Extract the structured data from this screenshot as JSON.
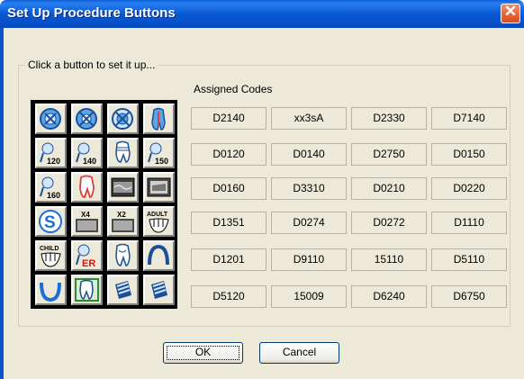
{
  "window": {
    "title": "Set Up Procedure Buttons"
  },
  "group": {
    "label": "Click a button to set it up..."
  },
  "assigned_codes_label": "Assigned Codes",
  "icon_buttons": [
    [
      "quadrant-icon",
      "quadrant-icon",
      "quadrant-icon",
      "tooth-section-icon"
    ],
    [
      "exam-120-icon",
      "exam-140-icon",
      "crown-icon",
      "exam-150-icon"
    ],
    [
      "exam-160-icon",
      "tooth-icon",
      "xray-film-icon",
      "xray-panoramic-icon"
    ],
    [
      "sealant-icon",
      "xray-x4-icon",
      "xray-x2-icon",
      "adult-denture-icon"
    ],
    [
      "child-denture-icon",
      "er-exam-icon",
      "extraction-icon",
      "arch-icon"
    ],
    [
      "lower-arch-icon",
      "tooth-highlighted-icon",
      "implant-icon",
      "implant-icon"
    ]
  ],
  "icon_text": {
    "r2c1": "120",
    "r2c2": "140",
    "r2c4": "150",
    "r3c1": "160",
    "r4c2": "X4",
    "r4c3": "X2",
    "r4c4": "ADULT",
    "r5c1": "CHILD",
    "r5c2": "ER",
    "r4c1": "S"
  },
  "codes": [
    [
      "D2140",
      "xx3sA",
      "D2330",
      "D7140"
    ],
    [
      "D0120",
      "D0140",
      "D2750",
      "D0150"
    ],
    [
      "D0160",
      "D3310",
      "D0210",
      "D0220"
    ],
    [
      "D1351",
      "D0274",
      "D0272",
      "D1110"
    ],
    [
      "D1201",
      "D9110",
      "15110",
      "D5110"
    ],
    [
      "D5120",
      "15009",
      "D6240",
      "D6750"
    ]
  ],
  "buttons": {
    "ok": "OK",
    "cancel": "Cancel"
  },
  "colors": {
    "titlebar": "#0a58d6",
    "dialog_bg": "#ece9d8",
    "close": "#d94a1e"
  }
}
